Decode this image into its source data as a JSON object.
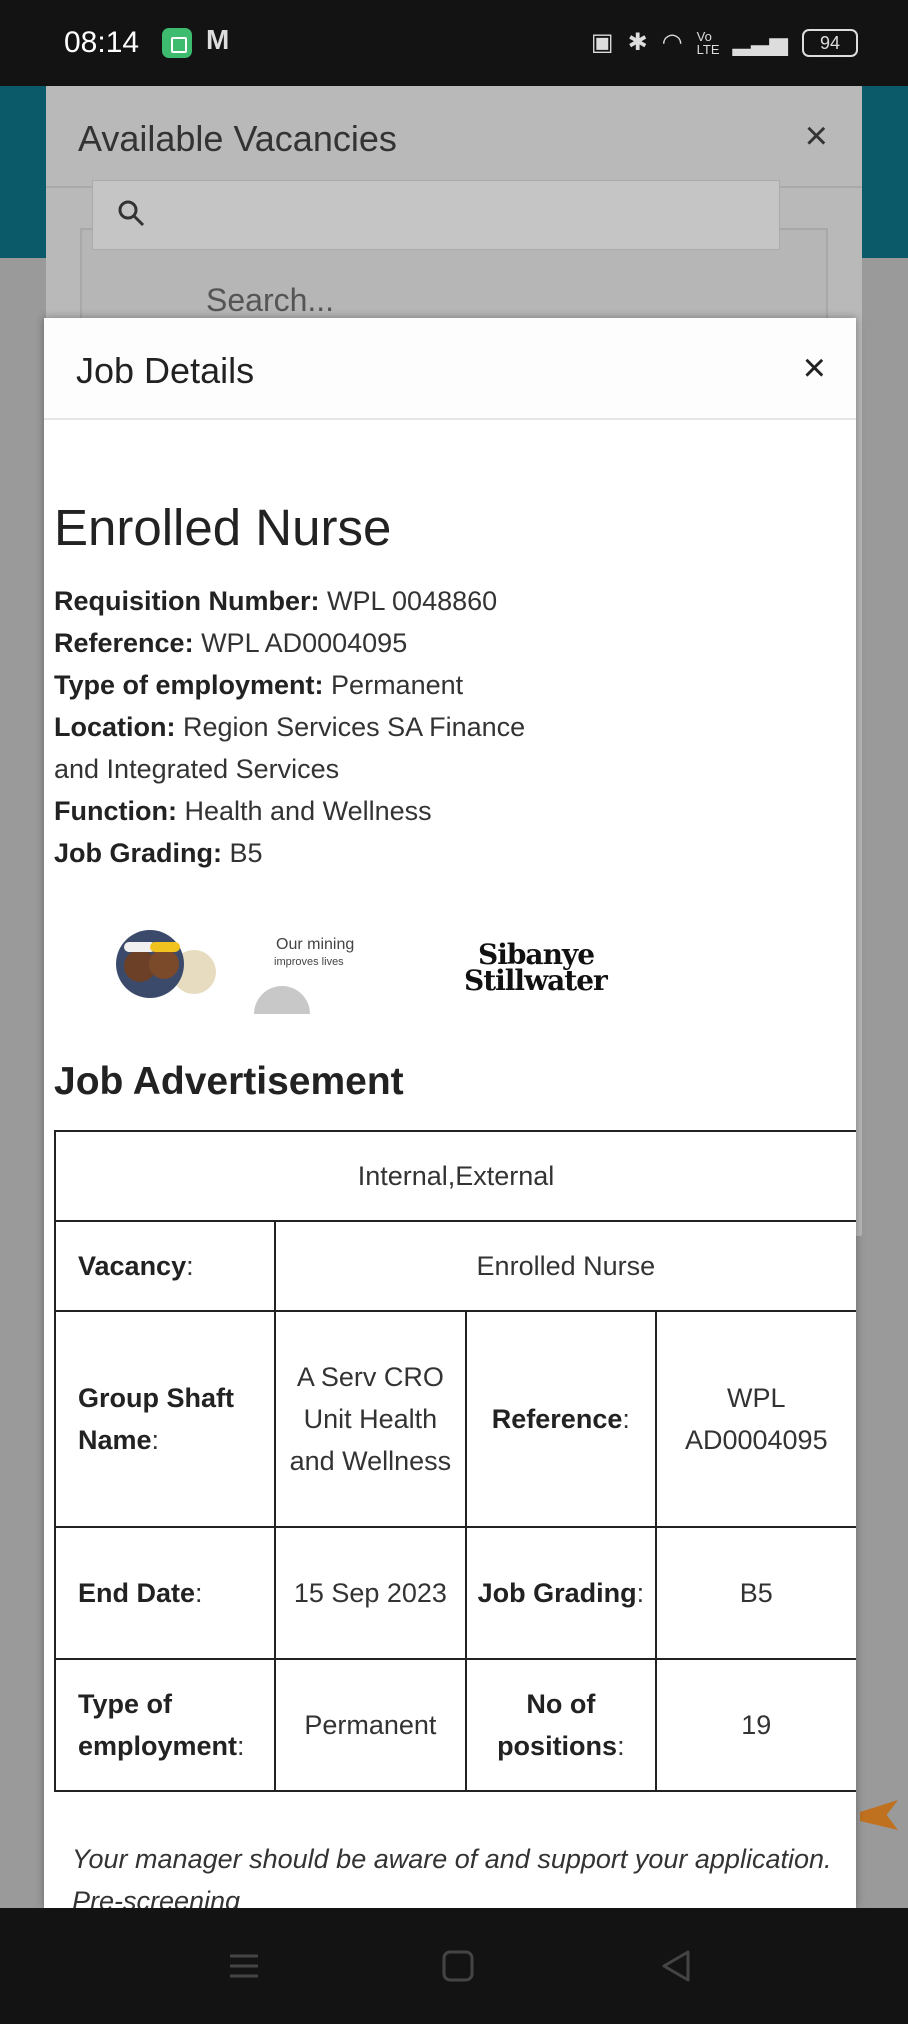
{
  "status_bar": {
    "time": "08:14",
    "mail_glyph": "M",
    "network_label": "Vo LTE",
    "battery": "94"
  },
  "vacancies_dialog": {
    "title": "Available Vacancies",
    "close": "×",
    "search_placeholder": "Search..."
  },
  "job_dialog": {
    "title": "Job Details",
    "close": "×",
    "job_title": "Enrolled Nurse",
    "details": [
      {
        "label": "Requisition Number:",
        "value": "WPL 0048860"
      },
      {
        "label": "Reference:",
        "value": "WPL AD0004095"
      },
      {
        "label": "Type of employment:",
        "value": "Permanent"
      },
      {
        "label": "Location:",
        "value": "Region Services SA Finance and Integrated Services"
      },
      {
        "label": "Function:",
        "value": "Health and Wellness"
      },
      {
        "label": "Job Grading:",
        "value": "B5"
      }
    ],
    "logos": {
      "slogan_line1": "Our mining",
      "slogan_line2": "improves lives",
      "brand_line1": "Sibanye",
      "brand_line2": "Stillwater"
    },
    "advertisement": {
      "heading": "Job Advertisement",
      "scope": "Internal,External",
      "vacancy_label": "Vacancy",
      "vacancy_value": "Enrolled Nurse",
      "group_shaft_label": "Group Shaft Name",
      "group_shaft_value": "A Serv CRO Unit Health and Wellness",
      "reference_label": "Reference",
      "reference_value": "WPL AD0004095",
      "end_date_label": "End Date",
      "end_date_value": "15 Sep 2023",
      "job_grading_label": "Job Grading",
      "job_grading_value": "B5",
      "employment_label": "Type of employment",
      "employment_value": "Permanent",
      "positions_label": "No of positions",
      "positions_value": "19"
    },
    "note": "Your manager should be aware of and support your application. Pre-screening"
  }
}
